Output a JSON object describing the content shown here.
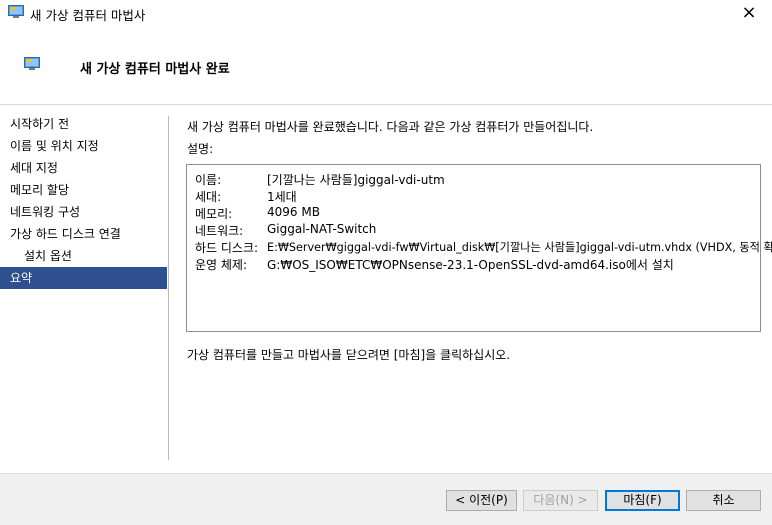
{
  "window": {
    "title": "새 가상 컴퓨터 마법사",
    "close_glyph": "×"
  },
  "header": {
    "title": "새 가상 컴퓨터 마법사 완료"
  },
  "sidebar": {
    "items": [
      {
        "label": "시작하기 전"
      },
      {
        "label": "이름 및 위치 지정"
      },
      {
        "label": "세대 지정"
      },
      {
        "label": "메모리 할당"
      },
      {
        "label": "네트워킹 구성"
      },
      {
        "label": "가상 하드 디스크 연결"
      },
      {
        "label": "설치 옵션"
      },
      {
        "label": "요약"
      }
    ],
    "active_index": 7
  },
  "content": {
    "intro": "새 가상 컴퓨터 마법사를 완료했습니다. 다음과 같은 가상 컴퓨터가 만들어집니다.",
    "description_label": "설명:",
    "summary": [
      {
        "key": "이름:",
        "value": "[기깔나는 사람들]giggal-vdi-utm"
      },
      {
        "key": "세대:",
        "value": "1세대"
      },
      {
        "key": "메모리:",
        "value": "4096 MB"
      },
      {
        "key": "네트워크:",
        "value": "Giggal-NAT-Switch"
      },
      {
        "key": "하드 디스크:",
        "value": "E:₩Server₩giggal-vdi-fw₩Virtual_disk₩[기깔나는 사람들]giggal-vdi-utm.vhdx (VHDX, 동적 확장)"
      },
      {
        "key": "운영 체제:",
        "value": "G:₩OS_ISO₩ETC₩OPNsense-23.1-OpenSSL-dvd-amd64.iso에서 설치"
      }
    ],
    "finish_note": "가상 컴퓨터를 만들고 마법사를 닫으려면 [마침]을 클릭하십시오."
  },
  "footer": {
    "prev_label": "< 이전(P)",
    "next_label": "다음(N) >",
    "finish_label": "마침(F)",
    "cancel_label": "취소"
  },
  "colors": {
    "active_nav_bg": "#2f4f8f",
    "footer_bg": "#f0f0f0",
    "default_button_border": "#0078d7"
  },
  "icons": {
    "app": "monitor-icon",
    "header": "monitor-icon",
    "close": "close-icon"
  }
}
